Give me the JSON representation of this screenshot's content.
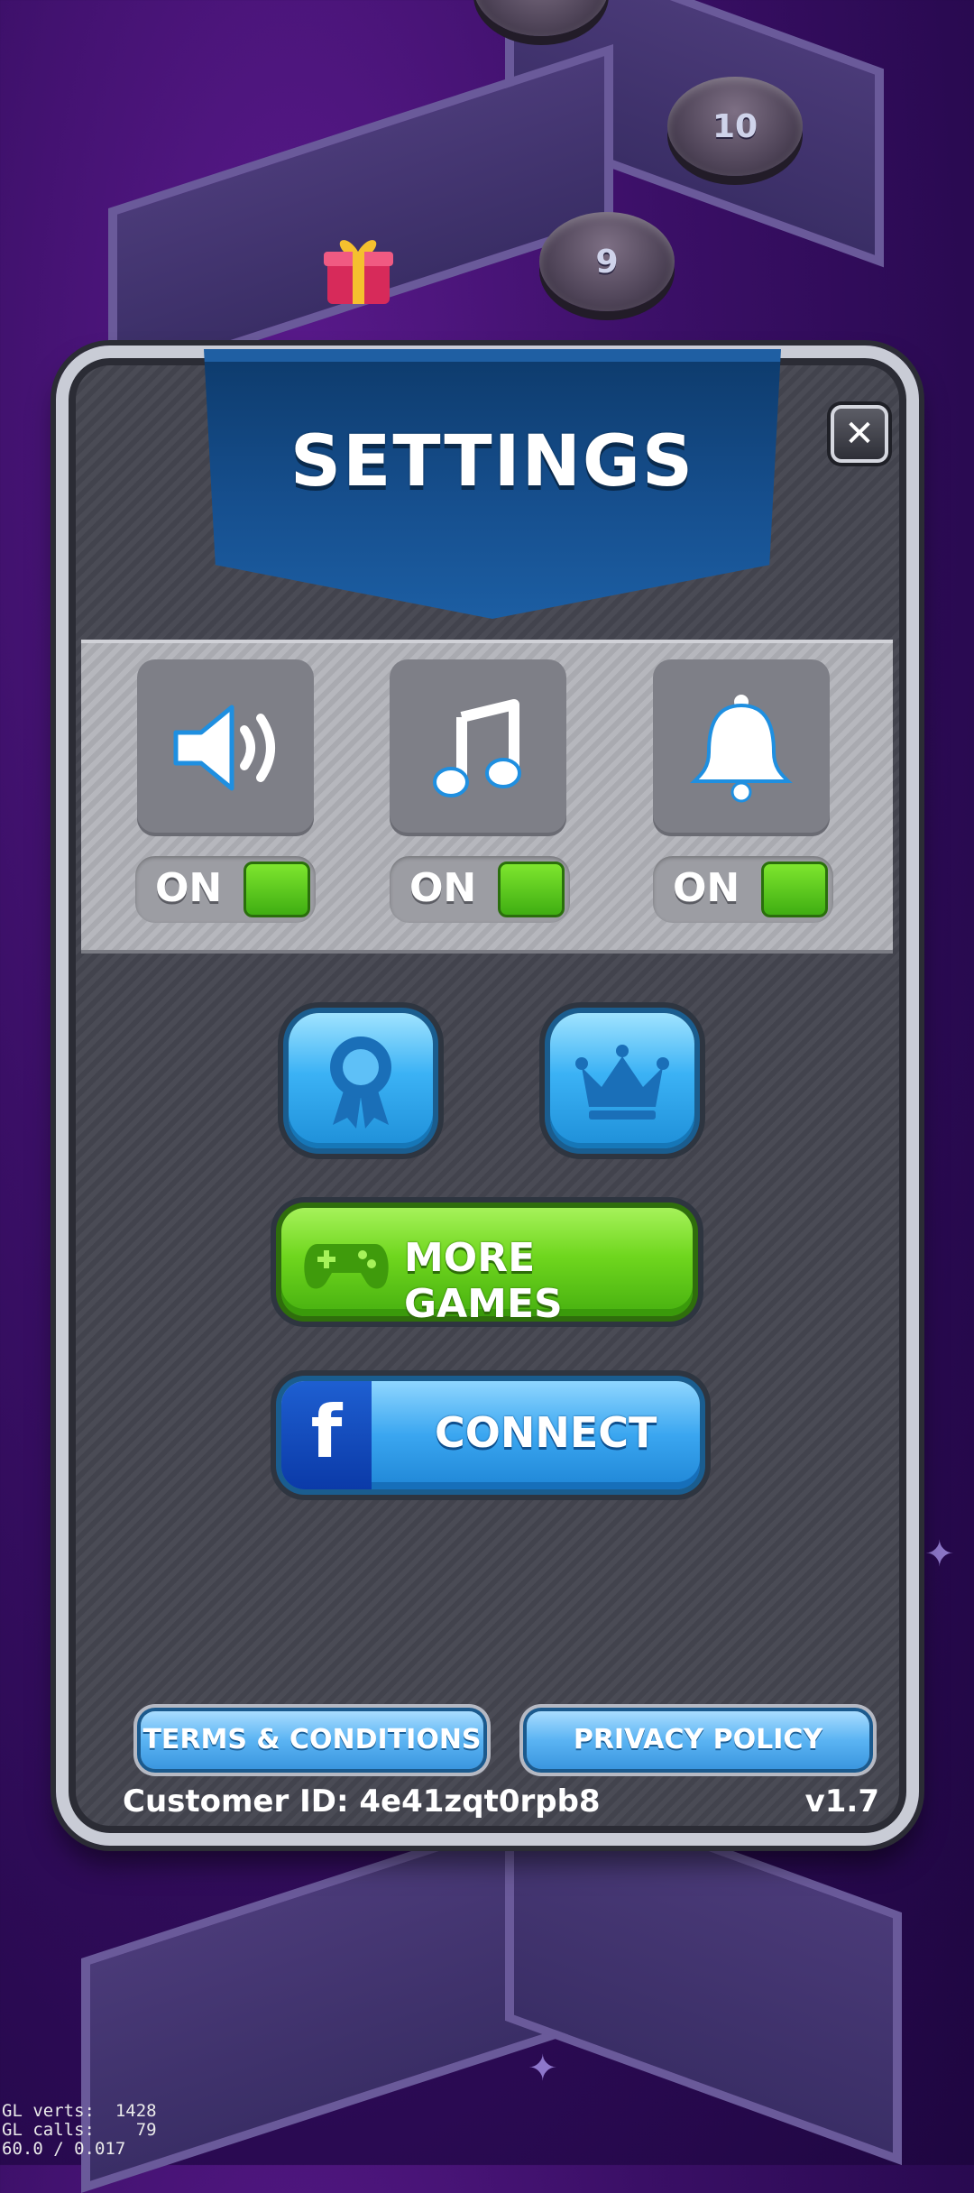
{
  "map": {
    "level_nodes": [
      {
        "number": "10"
      },
      {
        "number": "9"
      }
    ]
  },
  "settings": {
    "title": "SETTINGS",
    "close_label": "✕",
    "toggles": [
      {
        "icon": "speaker-icon",
        "label": "ON",
        "state": "on"
      },
      {
        "icon": "music-note-icon",
        "label": "ON",
        "state": "on"
      },
      {
        "icon": "bell-icon",
        "label": "ON",
        "state": "on"
      }
    ],
    "buttons": {
      "achievements_icon": "ribbon-award-icon",
      "leaderboard_icon": "crown-icon",
      "more_games": "MORE GAMES",
      "connect": "CONNECT",
      "facebook_letter": "f",
      "terms": "TERMS & CONDITIONS",
      "privacy": "PRIVACY POLICY"
    },
    "customer_id": "Customer ID: 4e41zqt0rpb8",
    "version": "v1.7"
  },
  "debug": {
    "line1": "GL verts:  1428",
    "line2": "GL calls:    79",
    "line3": "60.0 / 0.017"
  },
  "colors": {
    "toggle_on": "#5fcf1a",
    "accent_blue": "#3aa6f0",
    "accent_green": "#6fd61e"
  }
}
